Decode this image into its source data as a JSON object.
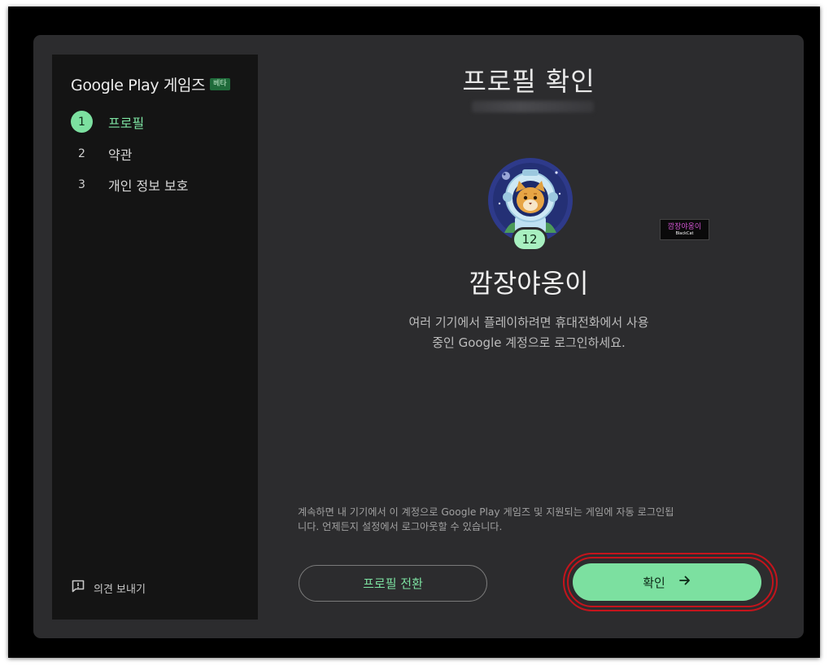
{
  "sidebar": {
    "brand": {
      "name": "Google Play 게임즈",
      "beta_badge": "베타"
    },
    "steps": [
      {
        "number": "1",
        "label": "프로필",
        "active": true
      },
      {
        "number": "2",
        "label": "약관",
        "active": false
      },
      {
        "number": "3",
        "label": "개인 정보 보호",
        "active": false
      }
    ],
    "feedback_label": "의견 보내기"
  },
  "main": {
    "title": "프로필 확인",
    "player": {
      "name": "깜장야옹이",
      "level": "12"
    },
    "description_line1": "여러 기기에서 플레이하려면 휴대전화에서 사용",
    "description_line2": "중인 Google 계정으로 로그인하세요.",
    "terms_line1": "계속하면 내 기기에서 이 계정으로 Google Play 게임즈 및 지원되는 게임에 자동 로그인됩",
    "terms_line2": "니다. 언제든지 설정에서 로그아웃할 수 있습니다.",
    "switch_profile_label": "프로필 전환",
    "confirm_label": "확인"
  },
  "watermark": {
    "title": "깜장야옹이",
    "subtitle": "BlackCat"
  },
  "colors": {
    "accent": "#7ce0a0",
    "background": "#2c2c2e",
    "sidebar": "#141414",
    "highlight": "#c4141c"
  },
  "icons": {
    "feedback": "feedback-icon",
    "arrow": "arrow-right-icon"
  }
}
